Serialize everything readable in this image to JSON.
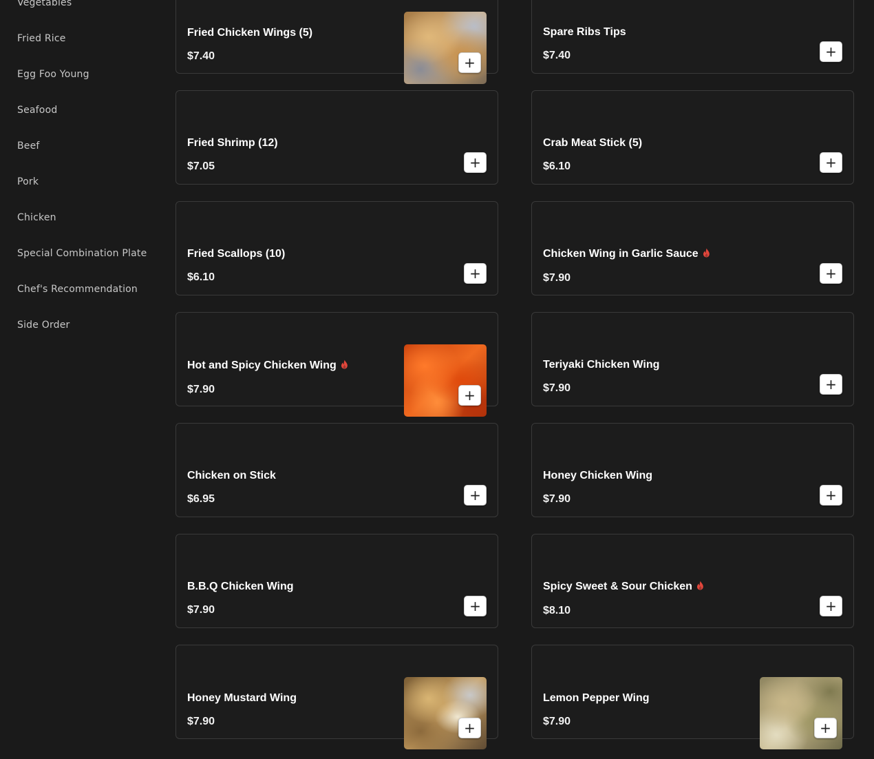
{
  "sidebar": {
    "items": [
      "Vegetables",
      "Fried Rice",
      "Egg Foo Young",
      "Seafood",
      "Beef",
      "Pork",
      "Chicken",
      "Special Combination Plate",
      "Chef's Recommendation",
      "Side Order"
    ]
  },
  "menu_items": [
    {
      "name": "Fried Chicken Wings (5)",
      "price": "$7.40",
      "spicy": false,
      "image": "img-wings"
    },
    {
      "name": "Spare Ribs Tips",
      "price": "$7.40",
      "spicy": false,
      "image": null
    },
    {
      "name": "Fried Shrimp (12)",
      "price": "$7.05",
      "spicy": false,
      "image": null
    },
    {
      "name": "Crab Meat Stick (5)",
      "price": "$6.10",
      "spicy": false,
      "image": null
    },
    {
      "name": "Fried Scallops (10)",
      "price": "$6.10",
      "spicy": false,
      "image": null
    },
    {
      "name": "Chicken Wing in Garlic Sauce",
      "price": "$7.90",
      "spicy": true,
      "image": null
    },
    {
      "name": "Hot and Spicy Chicken Wing",
      "price": "$7.90",
      "spicy": true,
      "image": "img-spicy"
    },
    {
      "name": "Teriyaki Chicken Wing",
      "price": "$7.90",
      "spicy": false,
      "image": null
    },
    {
      "name": "Chicken on Stick",
      "price": "$6.95",
      "spicy": false,
      "image": null
    },
    {
      "name": "Honey Chicken Wing",
      "price": "$7.90",
      "spicy": false,
      "image": null
    },
    {
      "name": "B.B.Q Chicken Wing",
      "price": "$7.90",
      "spicy": false,
      "image": null
    },
    {
      "name": "Spicy Sweet & Sour Chicken",
      "price": "$8.10",
      "spicy": true,
      "image": null
    },
    {
      "name": "Honey Mustard Wing",
      "price": "$7.90",
      "spicy": false,
      "image": "img-mustard"
    },
    {
      "name": "Lemon Pepper Wing",
      "price": "$7.90",
      "spicy": false,
      "image": "img-lemon"
    }
  ],
  "add_label": "+",
  "colors": {
    "background": "#1a1a1a",
    "card_border": "#3a3a3a",
    "spicy": "#e2463b",
    "text": "#ffffff",
    "nav_text": "#c8c8c8"
  },
  "icons": {
    "spicy": "flame-icon",
    "add": "plus-icon"
  }
}
